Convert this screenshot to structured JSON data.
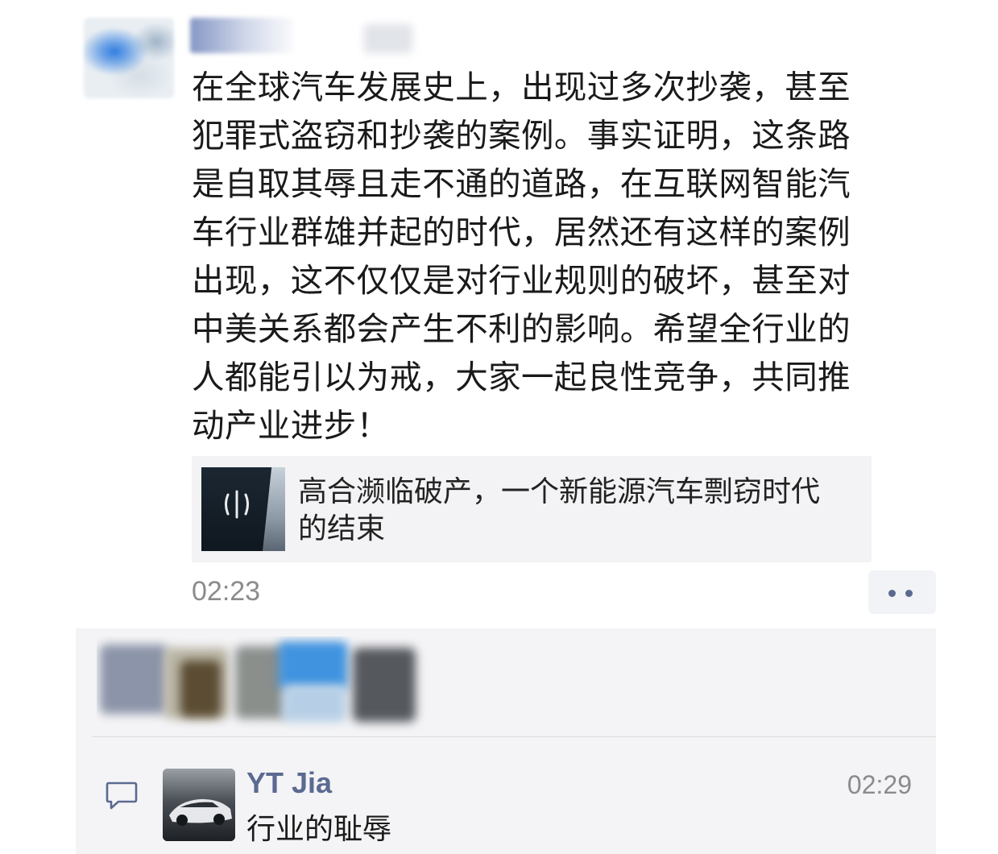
{
  "post": {
    "text_lines": [
      "在全球汽车发展史上，出现过多次抄袭，甚至",
      "犯罪式盗窃和抄袭的案例。事实证明，这条路",
      "是自取其辱且走不通的道路，在互联网智能汽",
      "车行业群雄并起的时代，居然还有这样的案例",
      "出现，这不仅仅是对行业规则的破坏，甚至对",
      "中美关系都会产生不利的影响。希望全行业的",
      "人都能引以为戒，大家一起良性竞争，共同推",
      "动产业进步！"
    ],
    "link_card": {
      "title_lines": [
        "高合濒临破产，一个新能源汽车剽窃时代",
        "的结束"
      ],
      "thumbnail_icon": "hiphi-logo-icon"
    },
    "timestamp": "02:23",
    "more_icon": "more-dots-icon"
  },
  "comments": [
    {
      "author": "YT Jia",
      "time": "02:29",
      "text": "行业的耻辱",
      "icon": "comment-bubble-icon"
    }
  ],
  "colors": {
    "name_link": "#5b6a92",
    "timestamp": "#8b8b8b",
    "card_bg": "#f3f3f5",
    "interaction_bg": "#f4f4f6",
    "more_dot": "#5a6a8e"
  }
}
